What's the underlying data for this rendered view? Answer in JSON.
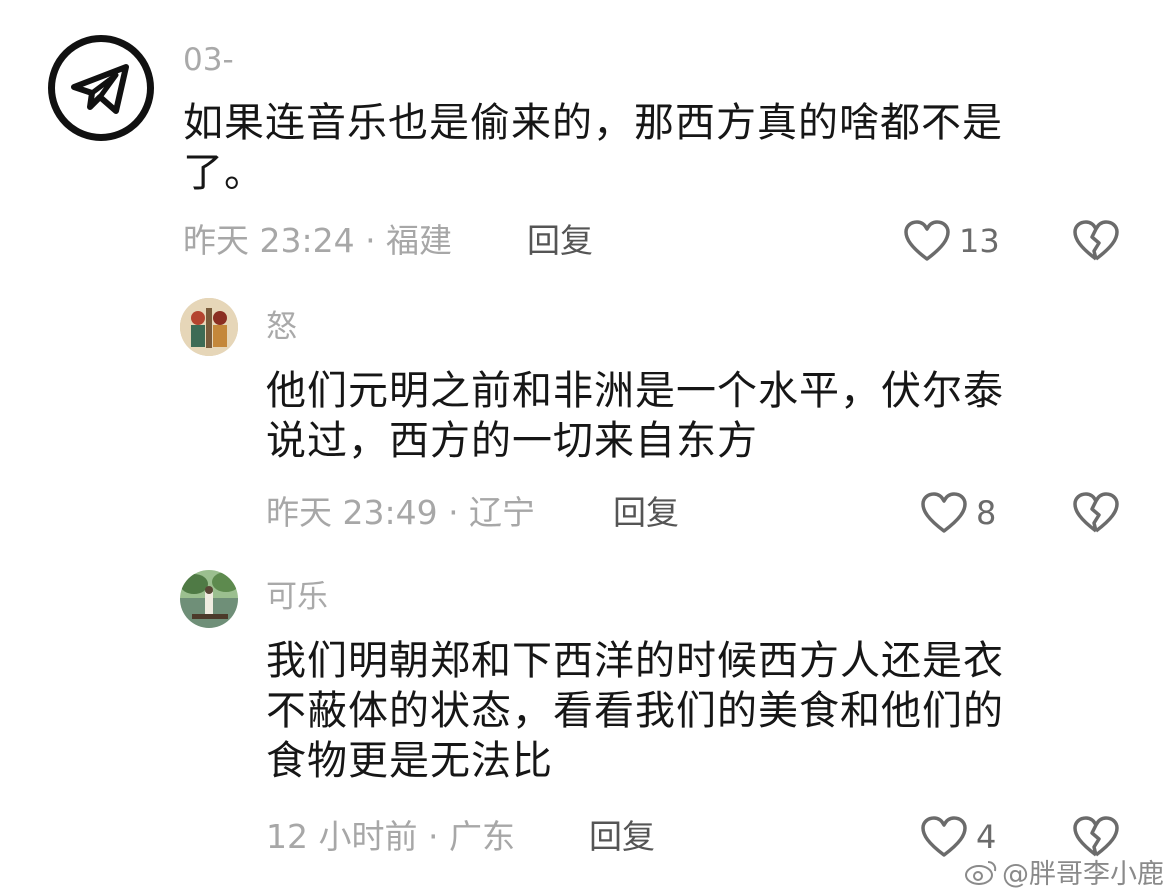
{
  "comments": [
    {
      "username": "03-",
      "text": "如果连音乐也是偷来的，那西方真的啥都不是\n了。",
      "meta": "昨天 23:24 · 福建",
      "reply_label": "回复",
      "likes": "13",
      "avatar_icon": "paper-plane-icon"
    },
    {
      "username": "怒",
      "text": "他们元明之前和非洲是一个水平，伏尔泰\n说过，西方的一切来自东方",
      "meta": "昨天 23:49 · 辽宁",
      "reply_label": "回复",
      "likes": "8"
    },
    {
      "username": "可乐",
      "text": "我们明朝郑和下西洋的时候西方人还是衣\n不蔽体的状态，看看我们的美食和他们的\n食物更是无法比",
      "meta": "12 小时前 · 广东",
      "reply_label": "回复",
      "likes": "4"
    }
  ],
  "watermark": "@胖哥李小鹿",
  "colors": {
    "meta": "#a7a7a7",
    "text": "#161616",
    "icon": "#6b6b6b"
  }
}
